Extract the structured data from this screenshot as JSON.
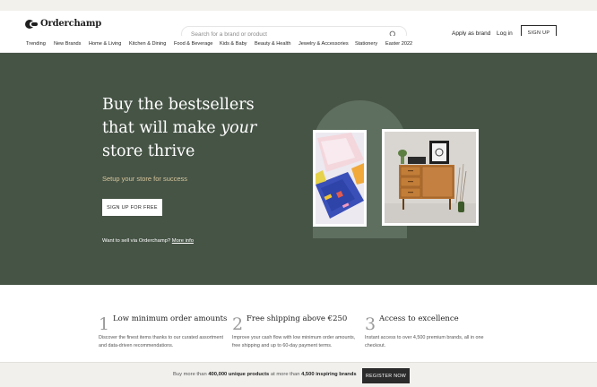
{
  "header": {
    "logo_text": "Orderchamp",
    "search_placeholder": "Search for a brand or product",
    "apply_label": "Apply as brand",
    "login_label": "Log in",
    "signup_label": "SIGN UP"
  },
  "nav": {
    "items": [
      {
        "label": "Trending"
      },
      {
        "label": "New Brands"
      },
      {
        "label": "Home & Living"
      },
      {
        "label": "Kitchen & Dining"
      },
      {
        "label": "Food & Beverage"
      },
      {
        "label": "Kids & Baby"
      },
      {
        "label": "Beauty & Health"
      },
      {
        "label": "Jewelry & Accessories"
      },
      {
        "label": "Stationery"
      },
      {
        "label": "Easter 2022"
      }
    ]
  },
  "hero": {
    "title_line1": "Buy the bestsellers",
    "title_line2_pre": "that will make ",
    "title_line2_em": "your",
    "title_line3": "store thrive",
    "subtitle": "Setup your store for success",
    "cta_label": "SIGN UP FOR FREE",
    "sell_text": "Want to sell via Orderchamp?",
    "sell_link": "More info"
  },
  "features": [
    {
      "num": "1",
      "title": "Low minimum order amounts",
      "text": "Discover the finest items thanks to our curated assortment and data-driven recommendations."
    },
    {
      "num": "2",
      "title": "Free shipping above €250",
      "text": "Improve your cash flow with low minimum order amounts, free shipping and up to 60-day payment terms."
    },
    {
      "num": "3",
      "title": "Access to excellence",
      "text": "Instant access to over 4,500 premium brands, all in one checkout."
    }
  ],
  "bottom_bar": {
    "text_pre": "Buy more than ",
    "products_count": "400,000 unique products",
    "text_mid": " at more than ",
    "brands_count": "4,500 inspiring brands",
    "register_label": "REGISTER NOW"
  },
  "colors": {
    "hero_bg": "#465446",
    "arch": "#5e6e5f",
    "subtitle": "#d6c59a",
    "register_bg": "#2b2b2b"
  },
  "icons": {
    "search": "search-icon",
    "logo": "orderchamp-logo-icon"
  }
}
